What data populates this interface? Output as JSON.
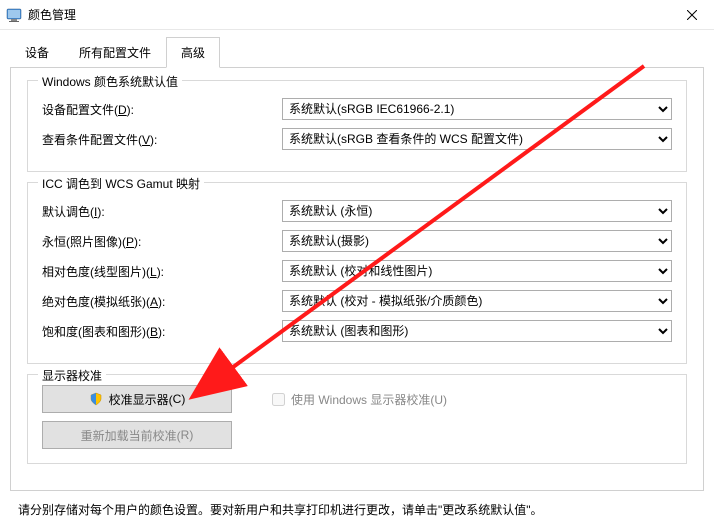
{
  "window": {
    "title": "颜色管理"
  },
  "tabs": {
    "device": "设备",
    "all_profiles": "所有配置文件",
    "advanced": "高级"
  },
  "group1": {
    "title": "Windows 颜色系统默认值",
    "device_profile_label_pre": "设备配置文件(",
    "device_profile_label_ul": "D",
    "device_profile_label_post": "):",
    "device_profile_value": "系统默认(sRGB IEC61966-2.1)",
    "view_cond_label_pre": "查看条件配置文件(",
    "view_cond_label_ul": "V",
    "view_cond_label_post": "):",
    "view_cond_value": "系统默认(sRGB 查看条件的 WCS 配置文件)"
  },
  "group2": {
    "title": "ICC 调色到 WCS Gamut 映射",
    "default_label_pre": "默认调色(",
    "default_label_ul": "I",
    "default_label_post": "):",
    "default_value": "系统默认 (永恒)",
    "perm_label_pre": "永恒(照片图像)(",
    "perm_label_ul": "P",
    "perm_label_post": "):",
    "perm_value": "系统默认(摄影)",
    "rel_label_pre": "相对色度(线型图片)(",
    "rel_label_ul": "L",
    "rel_label_post": "):",
    "rel_value": "系统默认 (校对和线性图片)",
    "abs_label_pre": "绝对色度(模拟纸张)(",
    "abs_label_ul": "A",
    "abs_label_post": "):",
    "abs_value": "系统默认 (校对 - 模拟纸张/介质颜色)",
    "sat_label_pre": "饱和度(图表和图形)(",
    "sat_label_ul": "B",
    "sat_label_post": "):",
    "sat_value": "系统默认 (图表和图形)"
  },
  "group3": {
    "title": "显示器校准",
    "calibrate_btn_pre": "校准显示器(",
    "calibrate_btn_ul": "C",
    "calibrate_btn_post": ")",
    "use_windows_calib_pre": "使用 Windows 显示器校准(",
    "use_windows_calib_ul": "U",
    "use_windows_calib_post": ")",
    "reload_btn_pre": "重新加载当前校准(",
    "reload_btn_ul": "R",
    "reload_btn_post": ")"
  },
  "footer": "请分别存储对每个用户的颜色设置。要对新用户和共享打印机进行更改，请单击\"更改系统默认值\"。"
}
